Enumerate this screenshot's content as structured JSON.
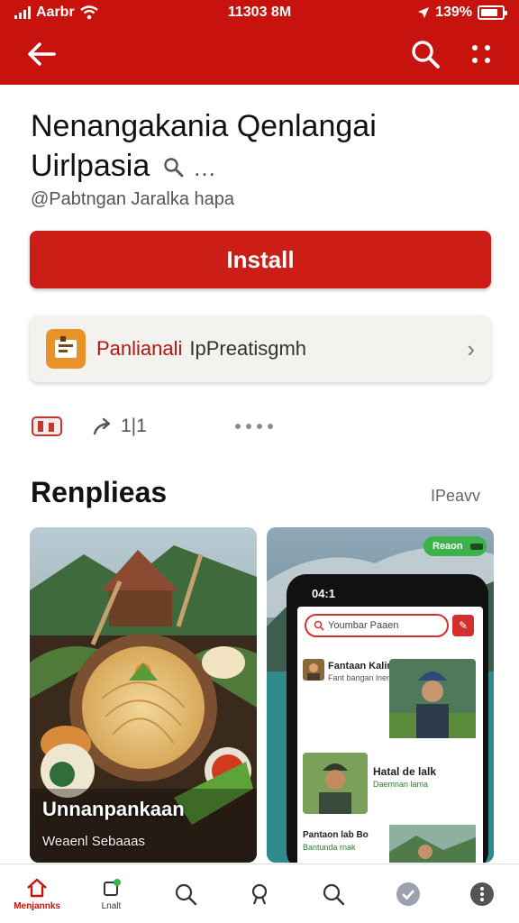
{
  "status_bar": {
    "carrier": "Aarbr",
    "time": "11303 8M",
    "battery": "139%",
    "battery_level": 0.8
  },
  "app_bar": {
    "back_icon": "arrow-left-icon",
    "search_icon": "search-icon",
    "more_icon": "more-vert-icon"
  },
  "app": {
    "title_line1": "Nenangakania Qenlangai",
    "title_line2": "Uirlpasia",
    "title_suffix": "...",
    "developer": "@Pabtngan Jaralka hapa"
  },
  "install": {
    "label": "Install"
  },
  "promo": {
    "highlight": "Panlianali",
    "text": "IpPreatisgmh",
    "chevron": "›"
  },
  "actions": {
    "share_count": "1|1"
  },
  "section": {
    "title": "Renplieas",
    "more_link": "IPeavv"
  },
  "screenshots": [
    {
      "caption": "Unnanpankaan",
      "subcaption": "Weaenl Sebaaas"
    },
    {
      "phone_time": "04:1",
      "pill_label": "Reaon",
      "search_placeholder": "Youmbar Paaen",
      "row1_label": "Fantaan Kalin",
      "row1_sub": "Fant bangan lnen",
      "row2_label": "Hatal de lalk",
      "row2_sub": "Daemnan lama",
      "row3_label": "Pantaon lab Bo",
      "row3_sub": "Bantunda rnak"
    }
  ],
  "bottom_nav": [
    {
      "label": "Menjannks",
      "icon": "home-icon",
      "active": true
    },
    {
      "label": "Lnalt",
      "icon": "apps-icon",
      "active": false
    },
    {
      "label": "",
      "icon": "search-icon",
      "active": false
    },
    {
      "label": "",
      "icon": "person-icon",
      "active": false
    },
    {
      "label": "",
      "icon": "search-icon",
      "active": false
    },
    {
      "label": "",
      "icon": "check-circle-icon",
      "active": false
    },
    {
      "label": "",
      "icon": "more-circle-icon",
      "active": false
    }
  ],
  "colors": {
    "brand": "#c8120e",
    "install": "#cc1d17",
    "promo_bg": "#f4f2ee",
    "pill": "#3bb34a"
  }
}
